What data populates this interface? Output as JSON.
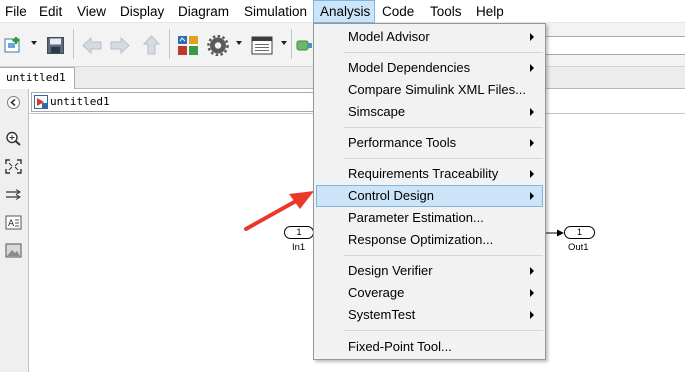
{
  "menubar": {
    "items": [
      "File",
      "Edit",
      "View",
      "Display",
      "Diagram",
      "Simulation",
      "Analysis",
      "Code",
      "Tools",
      "Help"
    ],
    "active": "Analysis"
  },
  "toolbar": {
    "icons": [
      "new-model-icon",
      "save-icon",
      "back-icon",
      "forward-icon",
      "up-icon",
      "library-browser-icon",
      "model-settings-icon",
      "model-explorer-icon",
      "run-icon"
    ]
  },
  "tabs": [
    {
      "label": "untitled1"
    }
  ],
  "breadcrumb": {
    "model": "untitled1"
  },
  "palette": {
    "icons": [
      "hide-browser-icon",
      "zoom-icon",
      "fit-view-icon",
      "signal-route-icon",
      "annotation-icon",
      "image-icon"
    ]
  },
  "canvas": {
    "inport": {
      "number": "1",
      "label": "In1"
    },
    "outport": {
      "number": "1",
      "label": "Out1"
    }
  },
  "analysis_menu": {
    "items": [
      {
        "label": "Model Advisor",
        "submenu": true
      },
      {
        "label": "Model Dependencies",
        "submenu": true
      },
      {
        "label": "Compare Simulink XML Files...",
        "submenu": false
      },
      {
        "label": "Simscape",
        "submenu": true
      },
      {
        "label": "Performance Tools",
        "submenu": true
      },
      {
        "label": "Requirements Traceability",
        "submenu": true
      },
      {
        "label": "Control Design",
        "submenu": true,
        "highlighted": true
      },
      {
        "label": "Parameter Estimation...",
        "submenu": false
      },
      {
        "label": "Response Optimization...",
        "submenu": false
      },
      {
        "label": "Design Verifier",
        "submenu": true
      },
      {
        "label": "Coverage",
        "submenu": true
      },
      {
        "label": "SystemTest",
        "submenu": true
      },
      {
        "label": "Fixed-Point Tool...",
        "submenu": false
      }
    ]
  },
  "colors": {
    "highlight": "#cce4f7",
    "highlight_border": "#82b4de",
    "annotation_arrow": "#e8392b"
  }
}
